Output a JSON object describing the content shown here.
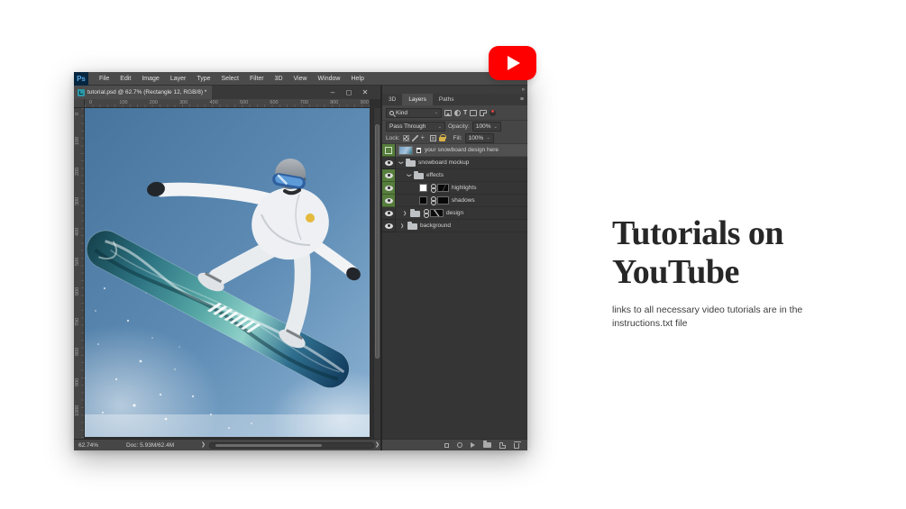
{
  "youtube": {
    "brand_color": "#ff0000",
    "icon": "play-triangle"
  },
  "hero": {
    "title": "Tutorials on YouTube",
    "subtitle": "links to all necessary video tutorials are in the instructions.txt file"
  },
  "photoshop": {
    "app_logo": "Ps",
    "menus": [
      "File",
      "Edit",
      "Image",
      "Layer",
      "Type",
      "Select",
      "Filter",
      "3D",
      "View",
      "Window",
      "Help"
    ],
    "document_tab": {
      "title": "tutorial.psd @ 62.7% (Rectangle 12, RGB/8) *"
    },
    "window_controls": {
      "minimize": "–",
      "maximize": "◻",
      "close": "✕"
    },
    "rulers": {
      "horizontal": [
        "0",
        "100",
        "200",
        "300",
        "400",
        "500",
        "600",
        "700",
        "800",
        "900"
      ],
      "vertical": [
        "0",
        "100",
        "200",
        "300",
        "400",
        "500",
        "600",
        "700",
        "800",
        "900",
        "1000"
      ]
    },
    "status_bar": {
      "zoom": "62.74%",
      "doc_info": "Doc: 5.93M/62.4M",
      "expander": "❯"
    },
    "layers_panel": {
      "tabs": [
        "3D",
        "Layers",
        "Paths"
      ],
      "active_tab": "Layers",
      "filter": {
        "label": "Kind"
      },
      "blend": {
        "mode": "Pass Through",
        "opacity_label": "Opacity:",
        "opacity": "100%"
      },
      "lock": {
        "label": "Lock:",
        "fill_label": "Fill:",
        "fill": "100%"
      },
      "label_color_green": "#567e3c",
      "layers": [
        {
          "name": "your snowboard design here",
          "type": "smart-object",
          "visible": false,
          "selected": true,
          "color_label": "green"
        },
        {
          "name": "snowboard mockup",
          "type": "group",
          "expanded": true,
          "visible": true
        },
        {
          "name": "effects",
          "type": "group",
          "expanded": true,
          "visible": true,
          "color_label": "green"
        },
        {
          "name": "highlights",
          "type": "layer-with-mask",
          "visible": true,
          "color_label": "green"
        },
        {
          "name": "shadows",
          "type": "layer-with-mask",
          "visible": true,
          "color_label": "green"
        },
        {
          "name": "design",
          "type": "group",
          "expanded": false,
          "visible": true
        },
        {
          "name": "background",
          "type": "group",
          "expanded": false,
          "visible": true
        }
      ]
    }
  }
}
